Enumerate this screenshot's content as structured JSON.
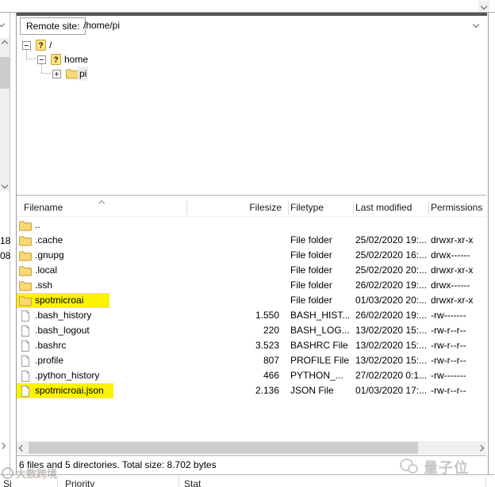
{
  "remote_bar": {
    "label": "Remote site:",
    "path": "/home/pi"
  },
  "tree": {
    "items": [
      {
        "label": "/",
        "icon": "question-folder",
        "expander": "minus",
        "level": 0,
        "selected": false
      },
      {
        "label": "home",
        "icon": "question-folder",
        "expander": "minus",
        "level": 1,
        "selected": false
      },
      {
        "label": "pi",
        "icon": "folder",
        "expander": "plus",
        "level": 2,
        "selected": true
      }
    ]
  },
  "file_list": {
    "columns": [
      "Filename",
      "Filesize",
      "Filetype",
      "Last modified",
      "Permissions"
    ],
    "sort": {
      "column": "Filename",
      "direction": "ascending"
    },
    "rows": [
      {
        "name": "..",
        "icon": "folder",
        "size": "",
        "type": "",
        "modified": "",
        "perms": "",
        "highlight": false
      },
      {
        "name": ".cache",
        "icon": "folder",
        "size": "",
        "type": "File folder",
        "modified": "25/02/2020 19:...",
        "perms": "drwxr-xr-x",
        "highlight": false
      },
      {
        "name": ".gnupg",
        "icon": "folder",
        "size": "",
        "type": "File folder",
        "modified": "25/02/2020 16:...",
        "perms": "drwx------",
        "highlight": false
      },
      {
        "name": ".local",
        "icon": "folder",
        "size": "",
        "type": "File folder",
        "modified": "25/02/2020 20:...",
        "perms": "drwxr-xr-x",
        "highlight": false
      },
      {
        "name": ".ssh",
        "icon": "folder",
        "size": "",
        "type": "File folder",
        "modified": "26/02/2020 19:...",
        "perms": "drwx------",
        "highlight": false
      },
      {
        "name": "spotmicroai",
        "icon": "folder",
        "size": "",
        "type": "File folder",
        "modified": "01/03/2020 20:...",
        "perms": "drwxr-xr-x",
        "highlight": true
      },
      {
        "name": ".bash_history",
        "icon": "file",
        "size": "1.550",
        "type": "BASH_HIST...",
        "modified": "26/02/2020 19:...",
        "perms": "-rw-------",
        "highlight": false
      },
      {
        "name": ".bash_logout",
        "icon": "file",
        "size": "220",
        "type": "BASH_LOG...",
        "modified": "13/02/2020 15:...",
        "perms": "-rw-r--r--",
        "highlight": false
      },
      {
        "name": ".bashrc",
        "icon": "file",
        "size": "3.523",
        "type": "BASHRC File",
        "modified": "13/02/2020 15:...",
        "perms": "-rw-r--r--",
        "highlight": false
      },
      {
        "name": ".profile",
        "icon": "file",
        "size": "807",
        "type": "PROFILE File",
        "modified": "13/02/2020 15:...",
        "perms": "-rw-r--r--",
        "highlight": false
      },
      {
        "name": ".python_history",
        "icon": "file",
        "size": "466",
        "type": "PYTHON_...",
        "modified": "27/02/2020 0:1...",
        "perms": "-rw-------",
        "highlight": false
      },
      {
        "name": "spotmicroai.json",
        "icon": "file",
        "size": "2.136",
        "type": "JSON File",
        "modified": "01/03/2020 17:...",
        "perms": "-rw-r--r--",
        "highlight": true
      }
    ]
  },
  "status_bar": {
    "text": "6 files and 5 directories. Total size: 8.702 bytes"
  },
  "queue_panel": {
    "partial_headers": [
      "Si",
      "Priority",
      "Stat"
    ]
  },
  "left_edge": {
    "filesize_fragments": [
      "18",
      "08"
    ]
  },
  "watermarks": {
    "bottom_left": "大数跨境",
    "bottom_right": "量子位"
  },
  "colors": {
    "highlight_marker": "#fbf300",
    "folder_fill": "#f9d873",
    "folder_stroke": "#c59a39",
    "splitter": "#565656",
    "scrollbar_track": "#f0f0f0",
    "scrollbar_thumb": "#cdcdcd"
  }
}
